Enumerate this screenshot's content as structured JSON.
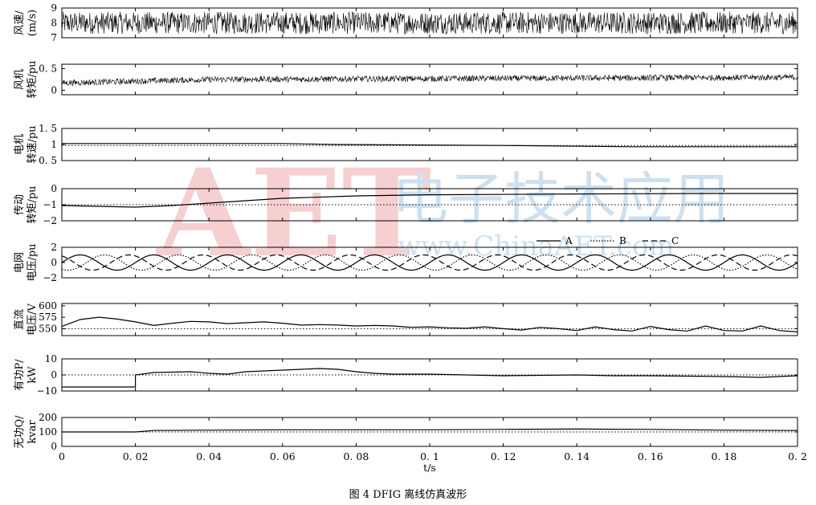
{
  "caption": "图 4   DFIG 离线仿真波形",
  "watermark": {
    "big": "AET",
    "url": "www.ChinaAET.com",
    "brand": "电子技术应用"
  },
  "chart_data": [
    {
      "type": "line",
      "ylabel": [
        "风速/",
        "(m/s)"
      ],
      "ylim": [
        7,
        9
      ],
      "yticks": [
        7,
        8,
        9
      ],
      "x": [
        0,
        0.2
      ],
      "series": [
        {
          "kind": "noise",
          "center": [
            8.0,
            8.0
          ],
          "amplitude": 0.75
        }
      ]
    },
    {
      "type": "line",
      "ylabel": [
        "风机",
        "转矩/pu"
      ],
      "ylim": [
        -0.1,
        0.6
      ],
      "yticks": [
        0,
        0.5
      ],
      "yticklabels": [
        "0",
        "0. 5"
      ],
      "x": [
        0,
        0.04,
        0.2
      ],
      "series": [
        {
          "kind": "noise",
          "center": [
            0.17,
            0.25,
            0.3
          ],
          "amplitude": 0.07
        }
      ]
    },
    {
      "type": "line",
      "ylabel": [
        "电机",
        "转速/pu"
      ],
      "ylim": [
        0.5,
        1.5
      ],
      "yticks": [
        0.5,
        1,
        1.5
      ],
      "yticklabels": [
        "0. 5",
        "1",
        "1. 5"
      ],
      "refline": 0.97,
      "series": [
        {
          "kind": "line",
          "points": [
            [
              0,
              1.03
            ],
            [
              0.06,
              1.03
            ],
            [
              0.075,
              1.0
            ],
            [
              0.12,
              0.97
            ],
            [
              0.155,
              0.93
            ],
            [
              0.2,
              0.93
            ]
          ]
        }
      ]
    },
    {
      "type": "line",
      "ylabel": [
        "传动",
        "转矩/pu"
      ],
      "ylim": [
        -2,
        0
      ],
      "yticks": [
        -2,
        -1,
        0
      ],
      "yticklabels": [
        "−2",
        "−1",
        "0"
      ],
      "refline": -1,
      "series": [
        {
          "kind": "line",
          "points": [
            [
              0,
              -1.05
            ],
            [
              0.02,
              -1.15
            ],
            [
              0.03,
              -1.05
            ],
            [
              0.04,
              -0.9
            ],
            [
              0.05,
              -0.75
            ],
            [
              0.06,
              -0.6
            ],
            [
              0.08,
              -0.45
            ],
            [
              0.1,
              -0.38
            ],
            [
              0.14,
              -0.33
            ],
            [
              0.18,
              -0.3
            ],
            [
              0.2,
              -0.3
            ]
          ]
        }
      ]
    },
    {
      "type": "line",
      "ylabel": [
        "电网",
        "电压/pu"
      ],
      "ylim": [
        -2,
        2
      ],
      "yticks": [
        -2,
        0,
        2
      ],
      "yticklabels": [
        "−2",
        "0",
        "2"
      ],
      "legend": [
        "A",
        "B",
        "C"
      ],
      "series": [
        {
          "name": "A",
          "kind": "sine",
          "amplitude": 1,
          "freq": 50,
          "phase": 0,
          "dash": ""
        },
        {
          "name": "B",
          "kind": "sine",
          "amplitude": 1,
          "freq": 50,
          "phase": -2.094,
          "dash": "1.5,2"
        },
        {
          "name": "C",
          "kind": "sine",
          "amplitude": 1,
          "freq": 50,
          "phase": 2.094,
          "dash": "7,4"
        }
      ]
    },
    {
      "type": "line",
      "ylabel": [
        "直流",
        "电压/V"
      ],
      "ylim": [
        535,
        605
      ],
      "yticks": [
        550,
        575,
        600
      ],
      "refline": 550,
      "series": [
        {
          "kind": "line",
          "points": [
            [
              0,
              555
            ],
            [
              0.005,
              570
            ],
            [
              0.01,
              575
            ],
            [
              0.015,
              571
            ],
            [
              0.02,
              565
            ],
            [
              0.025,
              557
            ],
            [
              0.03,
              562
            ],
            [
              0.035,
              566
            ],
            [
              0.04,
              565
            ],
            [
              0.045,
              561
            ],
            [
              0.05,
              563
            ],
            [
              0.055,
              565
            ],
            [
              0.06,
              562
            ],
            [
              0.065,
              558
            ],
            [
              0.07,
              559
            ],
            [
              0.075,
              558
            ],
            [
              0.08,
              556
            ],
            [
              0.085,
              557
            ],
            [
              0.09,
              556
            ],
            [
              0.095,
              553
            ],
            [
              0.1,
              554
            ],
            [
              0.105,
              552
            ],
            [
              0.11,
              551
            ],
            [
              0.115,
              554
            ],
            [
              0.12,
              550
            ],
            [
              0.125,
              547
            ],
            [
              0.13,
              553
            ],
            [
              0.135,
              550
            ],
            [
              0.14,
              546
            ],
            [
              0.145,
              554
            ],
            [
              0.15,
              548
            ],
            [
              0.155,
              545
            ],
            [
              0.16,
              555
            ],
            [
              0.165,
              548
            ],
            [
              0.17,
              545
            ],
            [
              0.175,
              556
            ],
            [
              0.18,
              546
            ],
            [
              0.185,
              545
            ],
            [
              0.19,
              556
            ],
            [
              0.195,
              546
            ],
            [
              0.2,
              543
            ]
          ]
        }
      ]
    },
    {
      "type": "line",
      "ylabel": [
        "有功P/",
        "kW"
      ],
      "ylim": [
        -10,
        10
      ],
      "yticks": [
        -10,
        0,
        10
      ],
      "yticklabels": [
        "−10",
        "0",
        "10"
      ],
      "refline": 0,
      "series": [
        {
          "kind": "line",
          "points": [
            [
              0,
              -7.5
            ],
            [
              0.02,
              -7.5
            ],
            [
              0.02,
              0
            ],
            [
              0.025,
              1.5
            ],
            [
              0.035,
              2
            ],
            [
              0.04,
              1
            ],
            [
              0.045,
              0.5
            ],
            [
              0.05,
              2
            ],
            [
              0.06,
              3
            ],
            [
              0.065,
              3.5
            ],
            [
              0.07,
              4
            ],
            [
              0.075,
              3.5
            ],
            [
              0.08,
              2
            ],
            [
              0.085,
              1
            ],
            [
              0.09,
              0.5
            ],
            [
              0.1,
              0.5
            ],
            [
              0.11,
              0
            ],
            [
              0.12,
              -0.5
            ],
            [
              0.14,
              0
            ],
            [
              0.15,
              -0.5
            ],
            [
              0.16,
              -0.5
            ],
            [
              0.18,
              -1
            ],
            [
              0.19,
              -1.5
            ],
            [
              0.2,
              -0.5
            ]
          ]
        }
      ]
    },
    {
      "type": "line",
      "ylabel": [
        "无功Q/",
        "kvar"
      ],
      "ylim": [
        0,
        200
      ],
      "yticks": [
        0,
        100,
        200
      ],
      "refline": 100,
      "xlabel": "t/s",
      "xticks": [
        0,
        0.02,
        0.04,
        0.06,
        0.08,
        0.1,
        0.12,
        0.14,
        0.16,
        0.18,
        0.2
      ],
      "xticklabels": [
        "0",
        "0. 02",
        "0. 04",
        "0. 06",
        "0. 08",
        "0. 1",
        "0. 12",
        "0. 14",
        "0. 16",
        "0. 18",
        "0. 2"
      ],
      "series": [
        {
          "kind": "line",
          "points": [
            [
              0,
              100
            ],
            [
              0.02,
              100
            ],
            [
              0.025,
              110
            ],
            [
              0.04,
              112
            ],
            [
              0.06,
              115
            ],
            [
              0.08,
              115
            ],
            [
              0.1,
              115
            ],
            [
              0.12,
              118
            ],
            [
              0.14,
              120
            ],
            [
              0.16,
              118
            ],
            [
              0.18,
              112
            ],
            [
              0.2,
              110
            ]
          ]
        }
      ]
    }
  ]
}
